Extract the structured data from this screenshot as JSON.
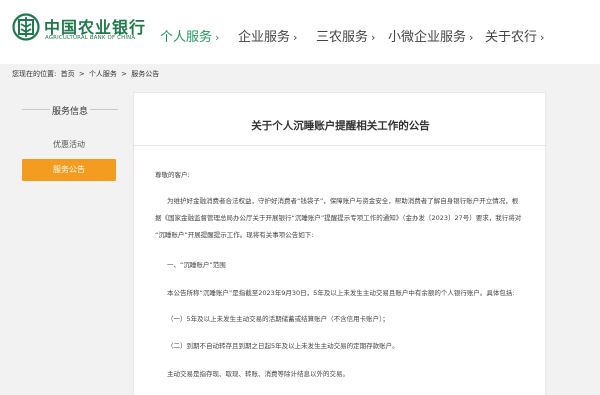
{
  "brand": {
    "name_cn": "中国农业银行",
    "name_en": "AGRICULTURAL BANK OF CHINA",
    "color": "#1e7a4a"
  },
  "nav": {
    "items": [
      {
        "label": "个人服务",
        "chev": "›",
        "active": true
      },
      {
        "label": "企业服务",
        "chev": "›",
        "active": false
      },
      {
        "label": "三农服务",
        "chev": "›",
        "active": false
      },
      {
        "label": "小微企业服务",
        "chev": "›",
        "active": false
      },
      {
        "label": "关于农行",
        "chev": "›",
        "active": false
      }
    ],
    "active_color": "#1e9b5b"
  },
  "breadcrumb": {
    "prefix": "您现在的位置:",
    "items": [
      "首页",
      "个人服务",
      "服务公告"
    ],
    "separator": ">"
  },
  "sidebar": {
    "title": "服务信息",
    "items": [
      {
        "label": "优惠活动",
        "active": false
      },
      {
        "label": "服务公告",
        "active": true
      }
    ],
    "active_color": "#f39c1f"
  },
  "article": {
    "title": "关于个人沉睡账户提醒相关工作的公告",
    "greeting": "尊敬的客户:",
    "lines": [
      "为维护好金融消费者合法权益，守护好消费者“钱袋子”，保障账户与资金安全，帮助消费者了解自身银行账户开立情况，根",
      "据《国家金融监督管理总局办公厅关于开展银行“沉睡账户”提醒提示专项工作的通知》（金办发〔2023〕27号）要求，我行将对",
      "“沉睡账户”开展提醒提示工作。现将有关事项公告如下:",
      "一、“沉睡账户”范围",
      "本公告所称“沉睡账户”是指截至2023年9月30日，5年及以上未发生主动交易且账户中有余额的个人银行账户。具体包括:",
      "（一）5年及以上未发生主动交易的活期储蓄或结算账户（不含信用卡账户）；",
      "（二）到期不自动转存且到期之日起5年及以上未发生主动交易的定期存款账户。",
      "主动交易是指存现、取现、转账、消费等除计结息以外的交易。"
    ]
  }
}
